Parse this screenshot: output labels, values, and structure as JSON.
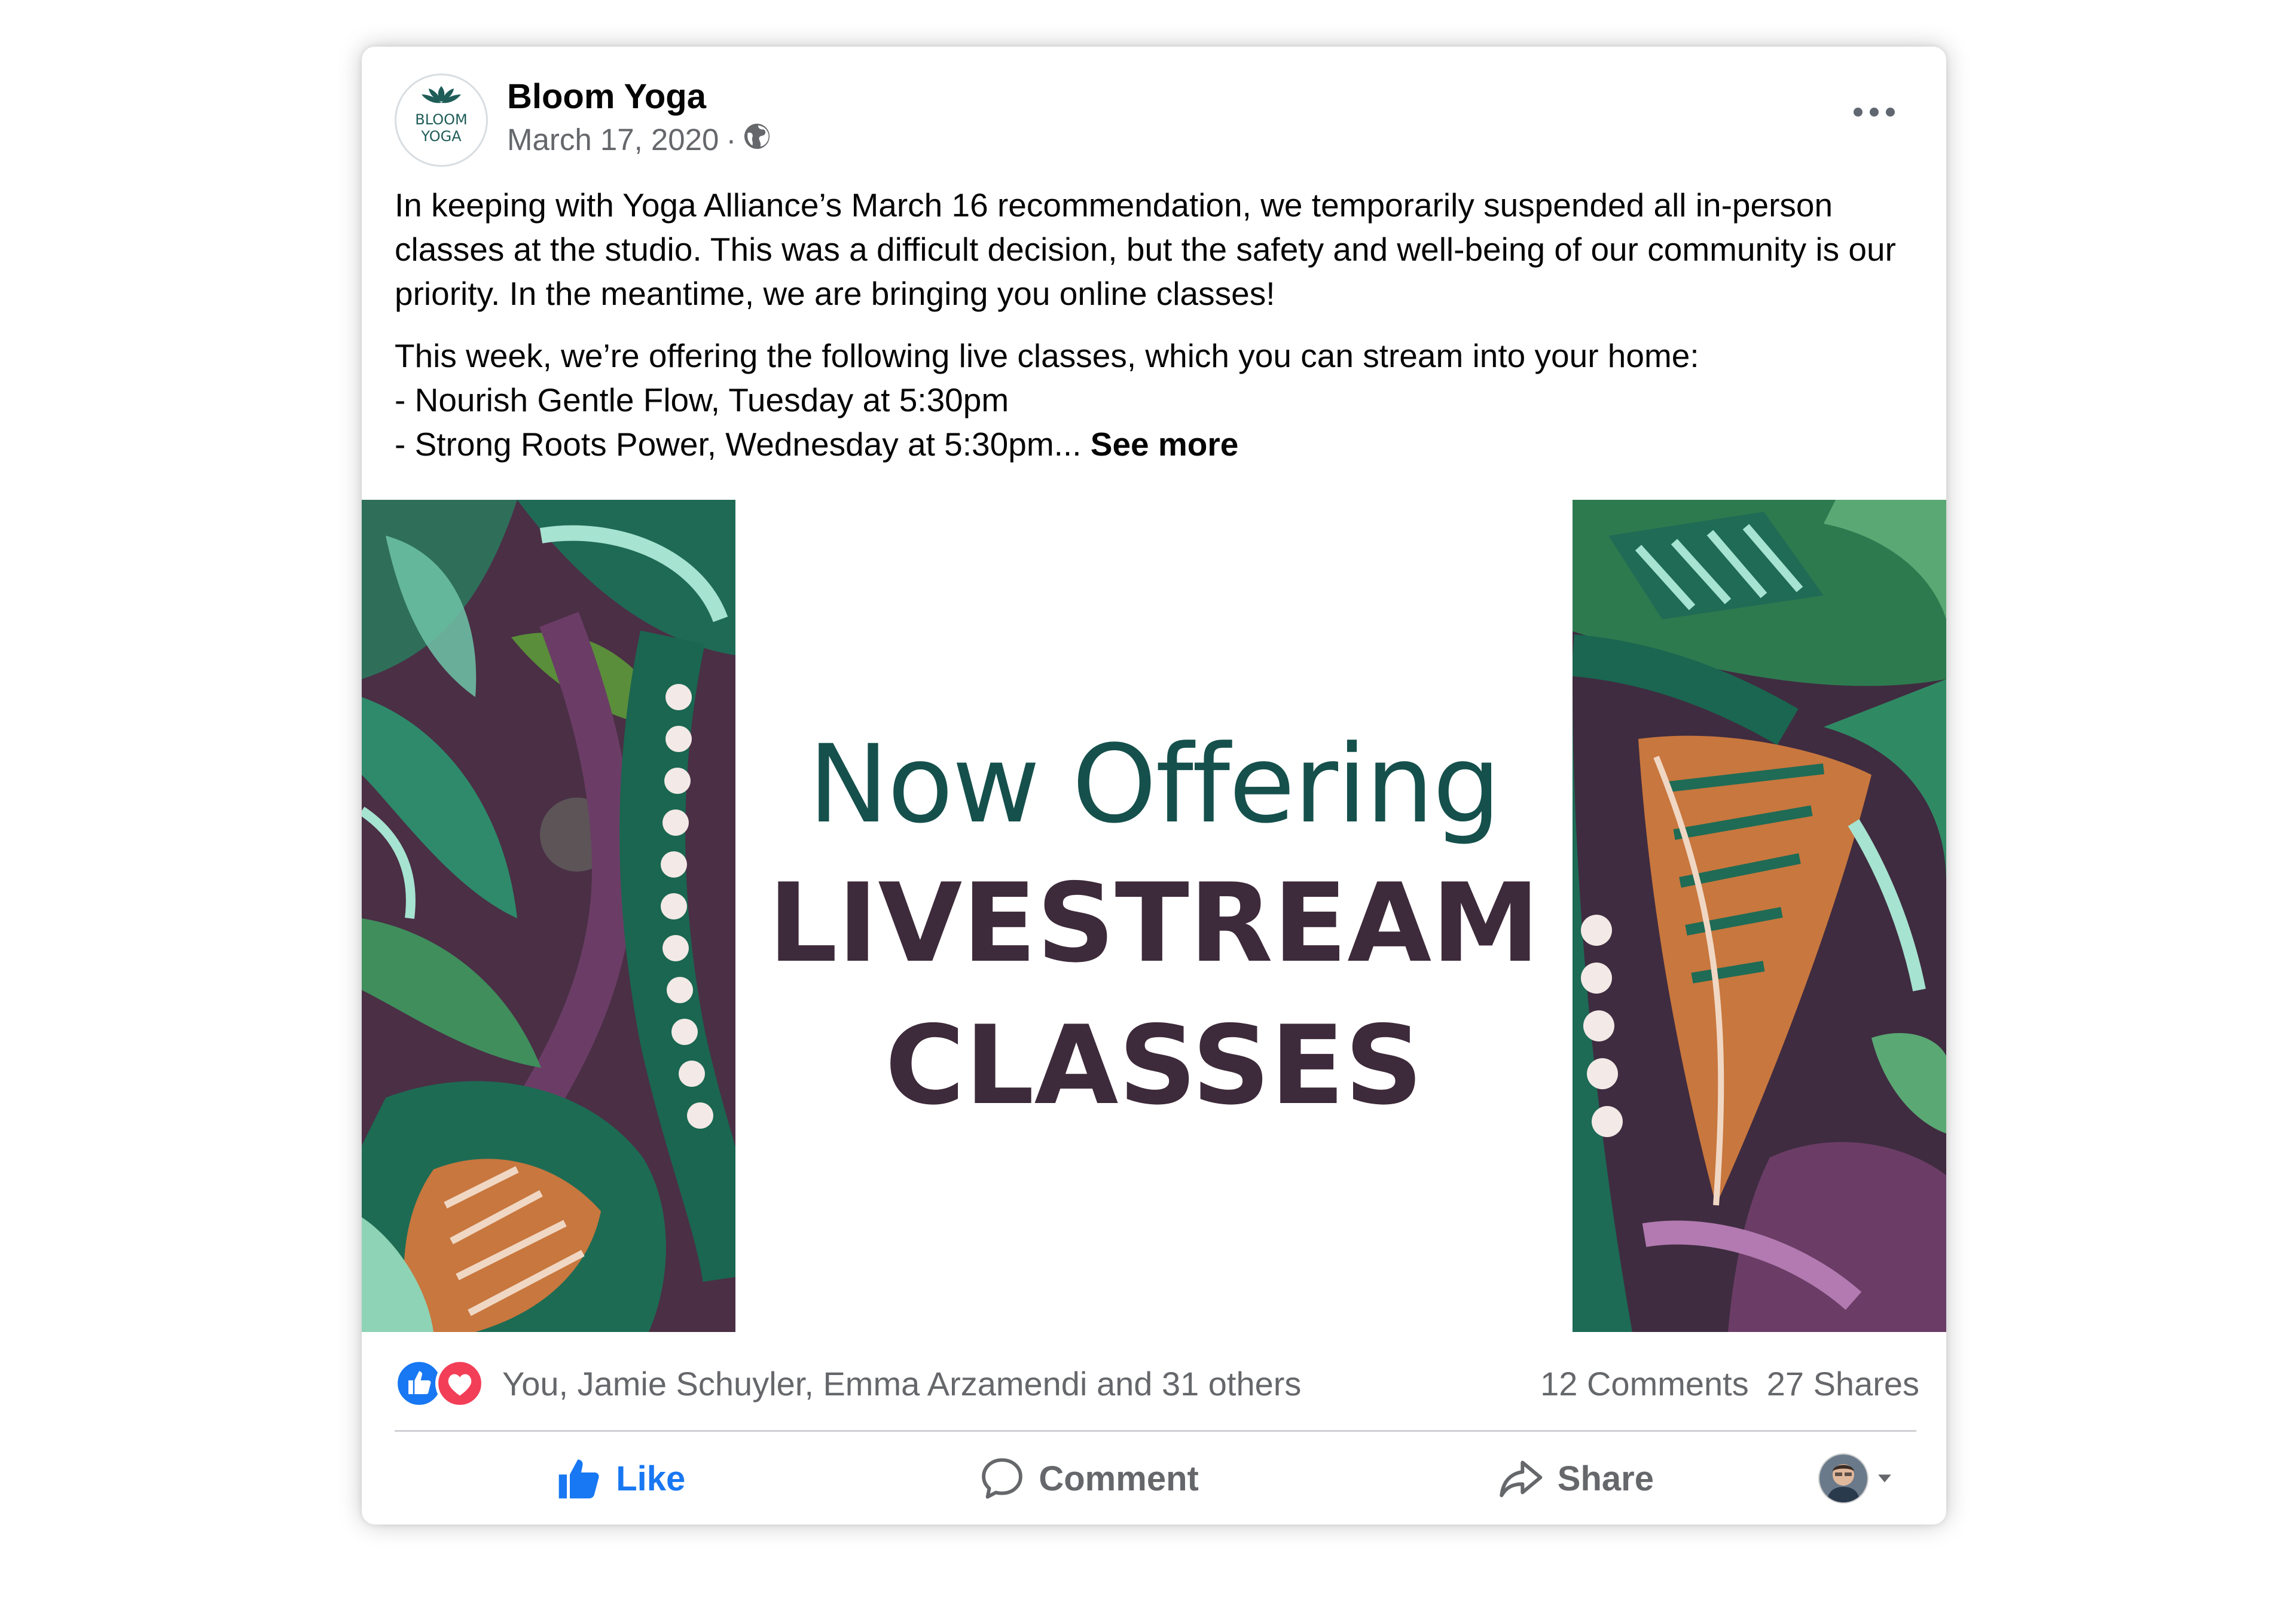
{
  "post": {
    "page_name": "Bloom Yoga",
    "logo_line1": "BLOOM",
    "logo_line2": "YOGA",
    "date": "March 17, 2020",
    "separator": "·",
    "audience_icon": "globe-icon",
    "more_icon": "more-options-icon",
    "paragraph1": "In keeping with Yoga Alliance’s March 16 recommendation, we temporarily suspended all in-person classes at the studio. This was a difficult decision, but the safety and well-being of our community is our priority. In the meantime, we are bringing you online classes!",
    "paragraph2_line1": "This week, we’re offering the following live classes, which you can stream into your home:",
    "paragraph2_line2": "- Nourish Gentle Flow, Tuesday at 5:30pm",
    "paragraph2_line3": "- Strong Roots Power, Wednesday at 5:30pm...",
    "see_more": "See more"
  },
  "image": {
    "line1": "Now Offering",
    "line2": "LIVESTREAM",
    "line3": "CLASSES"
  },
  "engagement": {
    "reactions": [
      "like-reaction-icon",
      "love-reaction-icon"
    ],
    "reactors_text": "You, Jamie Schuyler, Emma Arzamendi and 31 others",
    "comments": "12 Comments",
    "shares": "27 Shares"
  },
  "actions": {
    "like": "Like",
    "comment": "Comment",
    "share": "Share"
  },
  "colors": {
    "facebook_blue": "#1877f2",
    "love_red": "#f33e58",
    "text_gray": "#65676b",
    "headline_teal": "#15504c",
    "headline_plum": "#3d2a3a"
  }
}
